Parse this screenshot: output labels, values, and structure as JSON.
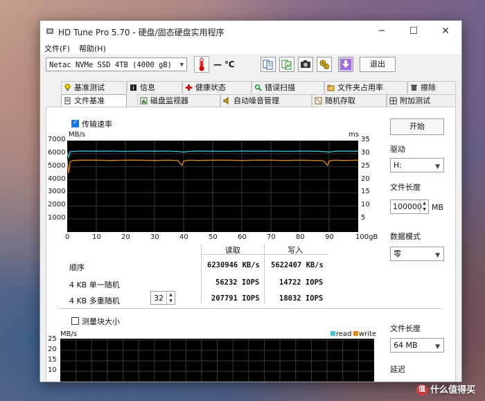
{
  "window": {
    "title": "HD Tune Pro 5.70 - 硬盘/固态硬盘实用程序"
  },
  "menu": {
    "file": "文件(F)",
    "help": "帮助(H)"
  },
  "toolbar": {
    "drive": "Netac NVMe SSD 4TB (4000 gB)",
    "temperature": "— ℃",
    "exit_label": "退出"
  },
  "tabs_row1": [
    "基准测试",
    "信息",
    "健康状态",
    "错误扫描",
    "文件夹占用率",
    "擦除"
  ],
  "tabs_row2": [
    "文件基准",
    "磁盘监视器",
    "自动噪音管理",
    "随机存取",
    "附加测试"
  ],
  "transfer": {
    "checkbox_label": "传输速率",
    "checked": true,
    "y_unit": "MB/s",
    "y2_unit": "ms",
    "y_ticks": [
      "7000",
      "6000",
      "5000",
      "4000",
      "3000",
      "2000",
      "1000"
    ],
    "y2_ticks": [
      "35",
      "30",
      "25",
      "20",
      "15",
      "10",
      "5"
    ],
    "x_ticks": [
      "0",
      "10",
      "20",
      "30",
      "40",
      "50",
      "60",
      "70",
      "80",
      "90",
      "100gB"
    ]
  },
  "results": {
    "header_read": "读取",
    "header_write": "写入",
    "rows": [
      {
        "label": "顺序",
        "read": "6230946 KB/s",
        "write": "5622407 KB/s"
      },
      {
        "label": "4 KB 单一随机",
        "read": "56232 IOPS",
        "write": "14722 IOPS"
      },
      {
        "label": "4 KB 多重随机",
        "read": "207791 IOPS",
        "write": "18032 IOPS"
      }
    ],
    "queue_depth": "32"
  },
  "side": {
    "start_button": "开始",
    "drive_label": "驱动",
    "drive_value": "H:",
    "file_length_label": "文件长度",
    "file_length_value": "100000",
    "file_length_unit": "MB",
    "data_mode_label": "数据模式",
    "data_mode_value": "零"
  },
  "block": {
    "checkbox_label": "测量块大小",
    "checked": false,
    "y_unit": "MB/s",
    "y_ticks": [
      "25",
      "20",
      "15",
      "10"
    ],
    "legend_read": "read",
    "legend_write": "write",
    "file_length_label": "文件长度",
    "file_length_value": "64 MB",
    "latency_label": "延迟"
  },
  "watermark": "值 什么值得买",
  "colors": {
    "read_line": "#3fc5e0",
    "write_line": "#e08a1e",
    "grid": "#3a3a3a"
  },
  "chart_data": {
    "type": "line",
    "title": "",
    "xlabel": "",
    "ylabel": "MB/s",
    "xlim": [
      0,
      100
    ],
    "ylim": [
      0,
      7000
    ],
    "y2lim": [
      0,
      35
    ],
    "series": [
      {
        "axis": "left",
        "x": [
          0,
          0.5,
          1,
          2,
          5,
          10,
          15,
          20,
          25,
          30,
          35,
          38,
          40,
          42,
          45,
          50,
          55,
          60,
          65,
          70,
          75,
          80,
          85,
          88,
          90,
          92,
          95,
          100
        ],
        "values": [
          6100,
          5700,
          6150,
          6180,
          6200,
          6190,
          6200,
          6180,
          6200,
          6190,
          6200,
          6170,
          6120,
          6180,
          6200,
          6190,
          6180,
          6200,
          6190,
          6200,
          6180,
          6200,
          6190,
          6170,
          6120,
          6190,
          6200,
          6190
        ]
      },
      {
        "axis": "right",
        "x": [
          0,
          0.5,
          1,
          2,
          5,
          10,
          15,
          20,
          25,
          30,
          35,
          38,
          39.5,
          40,
          42,
          45,
          50,
          55,
          60,
          65,
          70,
          75,
          80,
          85,
          88,
          89.5,
          90,
          92,
          95,
          100
        ],
        "values": [
          27.5,
          22.5,
          27,
          27.4,
          27.5,
          27.5,
          27.4,
          27.5,
          27.5,
          27.4,
          27.5,
          27.4,
          25.5,
          27.2,
          27.5,
          27.4,
          27.5,
          27.5,
          27.4,
          27.5,
          27.5,
          27.4,
          27.5,
          27.4,
          27.3,
          25.5,
          27.2,
          27.5,
          27.4,
          27.5
        ]
      }
    ]
  }
}
